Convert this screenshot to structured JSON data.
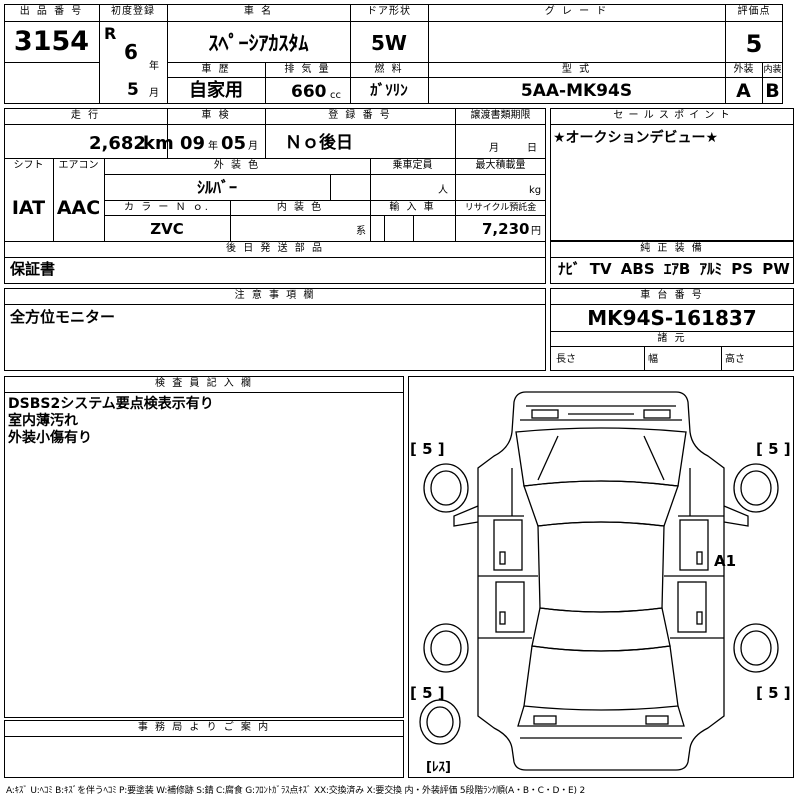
{
  "labels": {
    "lot_no": "出 品 番 号",
    "first_reg": "初度登録",
    "car_name": "車 名",
    "door": "ドア形状",
    "grade": "グ レ ー ド",
    "score": "評価点",
    "history": "車 歴",
    "displacement": "排 気 量",
    "fuel": "燃 料",
    "model": "型 式",
    "exterior": "外装",
    "interior": "内装",
    "mileage": "走 行",
    "inspection": "車 検",
    "plate": "登 録 番 号",
    "transfer": "譲渡書類期限",
    "sales_point": "セ ー ル ス ポ イ ン ト",
    "shift": "シフト",
    "aircon": "エアコン",
    "ext_color": "外 装 色",
    "capacity": "乗車定員",
    "max_load": "最大積載量",
    "color_no": "カ ラ ー Ｎ ｏ.",
    "int_color": "内 装 色",
    "import": "輸 入 車",
    "recycle": "リサイクル預託金",
    "later_parts": "後 日 発 送 部 品",
    "genuine": "純 正 装 備",
    "notes": "注 意 事 項 欄",
    "chassis": "車 台 番 号",
    "specs": "諸 元",
    "length": "長さ",
    "width": "幅",
    "height": "高さ",
    "inspector": "検 査 員 記 入 欄",
    "office": "事 務 局 よ り ご 案 内"
  },
  "units": {
    "year": "年",
    "month": "月",
    "cc": "cc",
    "km": "km",
    "persons": "人",
    "kg": "kg",
    "yen": "円",
    "color_suffix": "系",
    "transfer_month": "月",
    "transfer_day": "日"
  },
  "values": {
    "lot_no": "3154",
    "era": "R",
    "first_reg_year": "6",
    "first_reg_month": "5",
    "car_name": "ｽﾍﾟｰｼｱｶｽﾀﾑ",
    "door": "5W",
    "score": "5",
    "history": "自家用",
    "displacement": "660",
    "fuel": "ｶﾞｿﾘﾝ",
    "model": "5AA-MK94S",
    "exterior": "A",
    "interior": "B",
    "mileage": "2,682",
    "inspection_year": "09",
    "inspection_month": "05",
    "plate": "Ｎｏ後日",
    "sales_point": "★オークションデビュー★",
    "shift": "IAT",
    "aircon": "AAC",
    "ext_color": "ｼﾙﾊﾞｰ",
    "color_no": "ZVC",
    "recycle": "7,230",
    "later_parts": "保証書",
    "genuine": "ﾅﾋﾞ TV ABS ｴｱB ｱﾙﾐ PS PW",
    "notes": "全方位モニター",
    "chassis": "MK94S-161837"
  },
  "inspector_lines": [
    "DSBS2システム要点検表示有り",
    "室内薄汚れ",
    "外装小傷有り"
  ],
  "diagram": {
    "tire_fl": "[ 5 ]",
    "tire_fr": "[ 5 ]",
    "tire_rl": "[ 5 ]",
    "tire_rr": "[ 5 ]",
    "damage_mark": "A1",
    "spare": "[ﾚｽ]"
  },
  "legend": "A:ｷｽﾞ U:ﾍｺﾐ B:ｷｽﾞを伴うﾍｺﾐ P:要塗装 W:補修跡 S:錆 C:腐食 G:ﾌﾛﾝﾄｶﾞﾗｽ点ｷｽﾞ XX:交換済み X:要交換  内・外装評価  5段階ﾗﾝｸ順(A・B・C・D・E) 2"
}
